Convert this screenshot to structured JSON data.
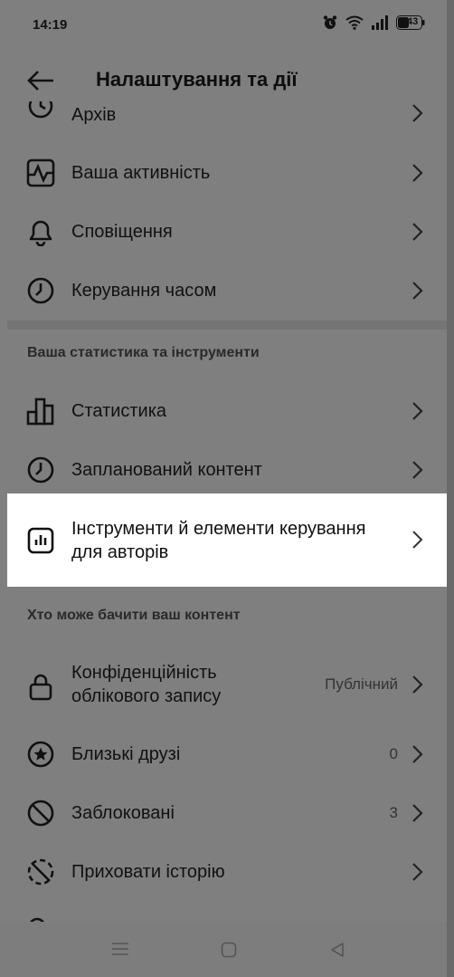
{
  "status_bar": {
    "time": "14:19",
    "battery": "43"
  },
  "header": {
    "title": "Налаштування та дії"
  },
  "items_top": [
    {
      "label": "Архів",
      "icon": "archive-icon"
    },
    {
      "label": "Ваша активність",
      "icon": "activity-icon"
    },
    {
      "label": "Сповіщення",
      "icon": "bell-icon"
    },
    {
      "label": "Керування часом",
      "icon": "clock-icon"
    }
  ],
  "section_tools": {
    "title": "Ваша статистика та інструменти"
  },
  "items_tools": [
    {
      "label": "Статистика",
      "icon": "bar-chart-icon"
    },
    {
      "label": "Запланований контент",
      "icon": "clock-icon"
    },
    {
      "label_line1": "Інструменти й елементи керування",
      "label_line2": "для авторів",
      "icon": "creator-tools-icon"
    }
  ],
  "section_visibility": {
    "title": "Хто може бачити ваш контент"
  },
  "items_visibility": [
    {
      "label_line1": "Конфіденційність",
      "label_line2": "облікового запису",
      "value": "Публічний",
      "icon": "lock-icon"
    },
    {
      "label": "Близькі друзі",
      "value": "0",
      "icon": "star-circle-icon"
    },
    {
      "label": "Заблоковані",
      "value": "3",
      "icon": "blocked-icon"
    },
    {
      "label": "Приховати історію",
      "icon": "hide-story-icon"
    }
  ],
  "colors": {
    "dim_overlay": "#7f7f7f",
    "highlight": "#ffffff"
  }
}
